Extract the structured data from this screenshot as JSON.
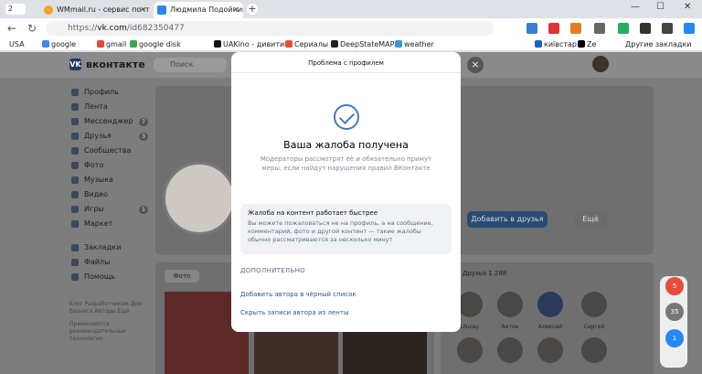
{
  "browser": {
    "tab_counter": "2",
    "tabs": [
      {
        "title": "WMmail.ru - сервис почто"
      },
      {
        "title": "Людмила Подойницы"
      }
    ],
    "url_scheme": "https://",
    "url_host": "vk.com",
    "url_path": "/id682350477",
    "new_tab": "+"
  },
  "bookmarks": [
    "USA",
    "google",
    "gmail",
    "google disk",
    "UAKino - дивитис",
    "Сериалы",
    "DeepStateMAP",
    "weather",
    "київстар",
    "Ze",
    "Другие закладки"
  ],
  "vk": {
    "brand": "вконтакте",
    "search_placeholder": "Поиск",
    "menu": [
      {
        "label": "Профиль"
      },
      {
        "label": "Лента"
      },
      {
        "label": "Мессенджер",
        "badge": "7"
      },
      {
        "label": "Друзья",
        "badge": "3"
      },
      {
        "label": "Сообщества"
      },
      {
        "label": "Фото"
      },
      {
        "label": "Музыка"
      },
      {
        "label": "Видео"
      },
      {
        "label": "Игры",
        "badge": "1"
      },
      {
        "label": "Маркет"
      },
      {
        "label": "Закладки"
      },
      {
        "label": "Файлы"
      },
      {
        "label": "Помощь"
      }
    ],
    "footer": "Блог Разработчикам Для бизнеса Авторы Ещё",
    "footer2": "Применяются рекомендательные технологии",
    "add_friend": "Добавить в друзья",
    "more": "Ещё",
    "photos_tab": "Фото",
    "friends_label": "Друзья 1 288",
    "friend_names": [
      "Ukulay",
      "Антон",
      "Алексей",
      "Сергей"
    ]
  },
  "modal": {
    "title": "Проблема с профилем",
    "heading": "Ваша жалоба получена",
    "text": "Модераторы рассмотрят её и обязательно примут меры, если найдут нарушения правил ВКонтакте",
    "info_title": "Жалоба на контент работает быстрее",
    "info_text": "Вы можете пожаловаться не на профиль, а на сообщение, комментарий, фото и другой контент — такие жалобы обычно рассматриваются за несколько минут",
    "more_header": "ДОПОЛНИТЕЛЬНО",
    "link_blacklist": "Добавить автора в чёрный список",
    "link_hide": "Скрыть записи автора из ленты",
    "close": "×"
  },
  "notifications": [
    "5",
    "35",
    "1"
  ]
}
